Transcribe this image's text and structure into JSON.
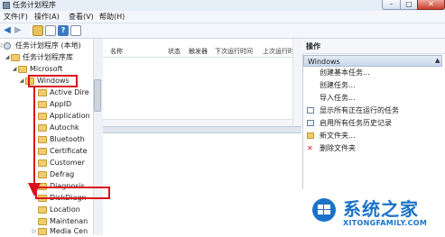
{
  "window": {
    "title": "任务计划程序",
    "minimize_label": "–",
    "maximize_label": "□",
    "close_label": "✕"
  },
  "menubar": {
    "items": [
      "文件(F)",
      "操作(A)",
      "查看(V)",
      "帮助(H)"
    ]
  },
  "toolbar": {
    "back_label": "◀",
    "forward_label": "▶",
    "help_label": "?"
  },
  "tree": {
    "items": [
      {
        "label": "任务计划程序 (本地)",
        "expander": "◁"
      },
      {
        "label": "任务计划程序库",
        "expander": "◢"
      },
      {
        "label": "Microsoft",
        "expander": "◢"
      },
      {
        "label": "Windows",
        "expander": "◢"
      },
      {
        "label": "Active Dire",
        "expander": ""
      },
      {
        "label": "AppID",
        "expander": ""
      },
      {
        "label": "Application",
        "expander": ""
      },
      {
        "label": "Autochk",
        "expander": ""
      },
      {
        "label": "Bluetooth",
        "expander": ""
      },
      {
        "label": "Certificate",
        "expander": ""
      },
      {
        "label": "Customer",
        "expander": ""
      },
      {
        "label": "Defrag",
        "expander": ""
      },
      {
        "label": "Diagnosis",
        "expander": ""
      },
      {
        "label": "DiskDiagn",
        "expander": ""
      },
      {
        "label": "Location",
        "expander": ""
      },
      {
        "label": "Maintenan",
        "expander": ""
      },
      {
        "label": "Media Cen",
        "expander": "▷"
      }
    ]
  },
  "list": {
    "columns": [
      "名称",
      "状态",
      "触发器",
      "下次运行时间",
      "上次运行时"
    ]
  },
  "actions": {
    "title": "操作",
    "section": "Windows",
    "section_chevron": "▲",
    "items": [
      {
        "label": "创建基本任务...",
        "icon": "none"
      },
      {
        "label": "创建任务...",
        "icon": "none"
      },
      {
        "label": "导入任务...",
        "icon": "none"
      },
      {
        "label": "显示所有正在运行的任务",
        "icon": "list-icon"
      },
      {
        "label": "启用所有任务历史记录",
        "icon": "history-icon"
      },
      {
        "label": "新文件夹...",
        "icon": "folder-icon"
      },
      {
        "label": "删除文件夹",
        "icon": "delete-icon"
      }
    ]
  },
  "watermark": {
    "title": "系统之家",
    "subtitle": "XITONGFAMILY.COM"
  },
  "colors": {
    "annotation_red": "#d8121a",
    "watermark_blue": "#1b73c9",
    "section_header": "#c9d8ec"
  }
}
